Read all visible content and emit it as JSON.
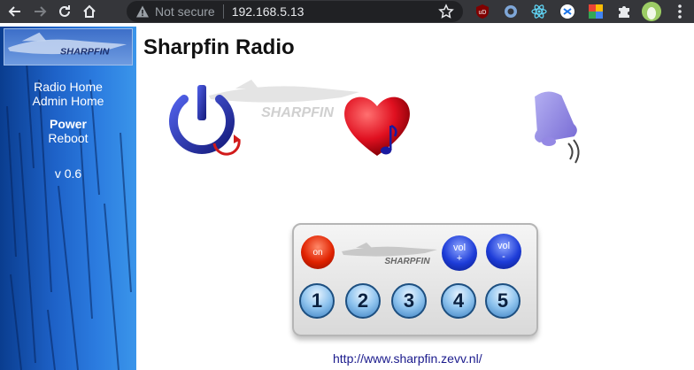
{
  "browser": {
    "security_label": "Not secure",
    "url": "192.168.5.13",
    "extensions": [
      "ublock-icon",
      "circle-ext-icon",
      "react-icon",
      "dropbox-ext-icon",
      "colorful-ext-icon",
      "puzzle-icon"
    ]
  },
  "sidebar": {
    "logo_text": "SHARPFIN",
    "radio_home": "Radio Home",
    "admin_home": "Admin Home",
    "power": "Power",
    "reboot": "Reboot",
    "version": "v 0.6"
  },
  "main": {
    "title": "Sharpfin Radio",
    "watermark_text": "SHARPFIN",
    "icons": [
      "power-icon",
      "heart-music-icon",
      "bell-icon"
    ]
  },
  "remote": {
    "brand": "SHARPFIN",
    "on_label": "on",
    "vol_up": {
      "line1": "vol",
      "line2": "+"
    },
    "vol_down": {
      "line1": "vol",
      "line2": "-"
    },
    "presets": [
      "1",
      "2",
      "3",
      "4",
      "5"
    ]
  },
  "footer": {
    "link": "http://www.sharpfin.zevv.nl/"
  },
  "colors": {
    "chrome": "#35363a",
    "omnibox": "#202124",
    "sidebar": "#1e62c8",
    "power_blue": "#1e2a9c",
    "heart_red": "#e01020"
  }
}
